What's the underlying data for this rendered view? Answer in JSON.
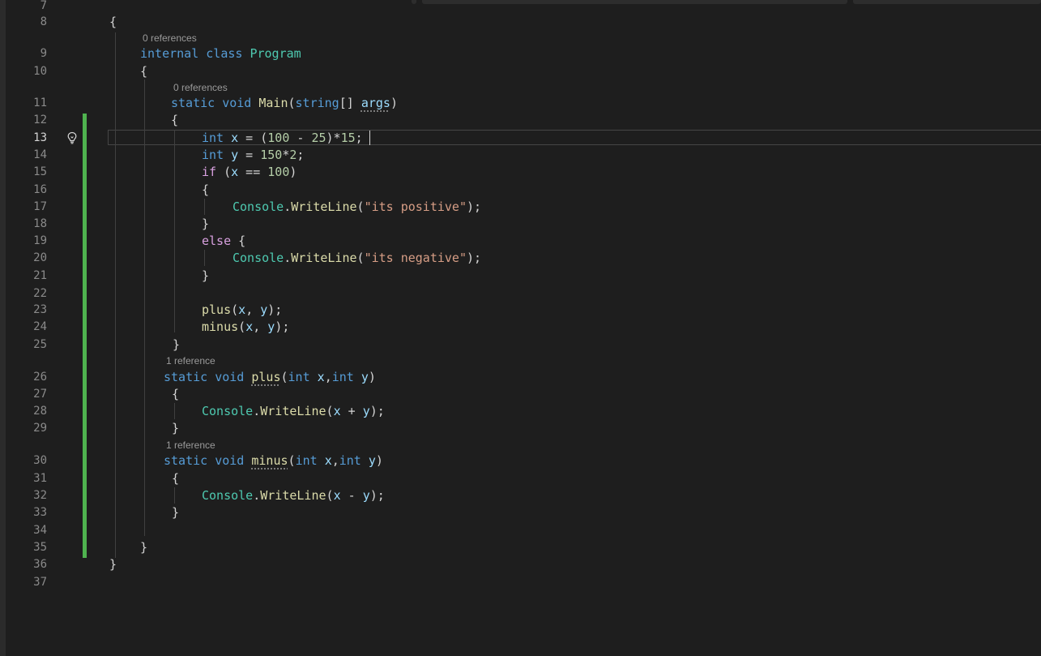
{
  "editor": {
    "active_line": "13",
    "lines": [
      {
        "num": "7"
      },
      {
        "num": "8",
        "t": [
          {
            "c": "p",
            "v": "{"
          }
        ]
      },
      {
        "lens": "0 references"
      },
      {
        "num": "9",
        "t": [
          {
            "c": "kw",
            "v": "internal class "
          },
          {
            "c": "type",
            "v": "Program"
          }
        ]
      },
      {
        "num": "10",
        "t": [
          {
            "c": "p",
            "v": "{"
          }
        ]
      },
      {
        "lens": "0 references"
      },
      {
        "num": "11",
        "t": [
          {
            "c": "kw",
            "v": "static void "
          },
          {
            "c": "fn",
            "v": "Main"
          },
          {
            "c": "p",
            "v": "("
          },
          {
            "c": "kw",
            "v": "string"
          },
          {
            "c": "p",
            "v": "[] "
          },
          {
            "c": "var squig",
            "v": "args"
          },
          {
            "c": "p",
            "v": ")"
          }
        ]
      },
      {
        "num": "12",
        "t": [
          {
            "c": "p",
            "v": "{"
          }
        ]
      },
      {
        "num": "13",
        "t": [
          {
            "c": "kw",
            "v": "int "
          },
          {
            "c": "var",
            "v": "x"
          },
          {
            "c": "p",
            "v": " = ("
          },
          {
            "c": "num",
            "v": "100"
          },
          {
            "c": "p",
            "v": " - "
          },
          {
            "c": "num",
            "v": "25"
          },
          {
            "c": "p",
            "v": ")*"
          },
          {
            "c": "num",
            "v": "15"
          },
          {
            "c": "p",
            "v": ";"
          }
        ]
      },
      {
        "num": "14",
        "t": [
          {
            "c": "kw",
            "v": "int "
          },
          {
            "c": "var",
            "v": "y"
          },
          {
            "c": "p",
            "v": " = "
          },
          {
            "c": "num",
            "v": "150"
          },
          {
            "c": "p",
            "v": "*"
          },
          {
            "c": "num",
            "v": "2"
          },
          {
            "c": "p",
            "v": ";"
          }
        ]
      },
      {
        "num": "15",
        "t": [
          {
            "c": "ctl",
            "v": "if"
          },
          {
            "c": "p",
            "v": " ("
          },
          {
            "c": "var",
            "v": "x"
          },
          {
            "c": "p",
            "v": " == "
          },
          {
            "c": "num",
            "v": "100"
          },
          {
            "c": "p",
            "v": ")"
          }
        ]
      },
      {
        "num": "16",
        "t": [
          {
            "c": "p",
            "v": "{"
          }
        ]
      },
      {
        "num": "17",
        "t": [
          {
            "c": "type",
            "v": "Console"
          },
          {
            "c": "p",
            "v": "."
          },
          {
            "c": "fn",
            "v": "WriteLine"
          },
          {
            "c": "p",
            "v": "("
          },
          {
            "c": "str",
            "v": "\"its positive\""
          },
          {
            "c": "p",
            "v": ");"
          }
        ]
      },
      {
        "num": "18",
        "t": [
          {
            "c": "p",
            "v": "}"
          }
        ]
      },
      {
        "num": "19",
        "t": [
          {
            "c": "ctl",
            "v": "else"
          },
          {
            "c": "p",
            "v": " {"
          }
        ]
      },
      {
        "num": "20",
        "t": [
          {
            "c": "type",
            "v": "Console"
          },
          {
            "c": "p",
            "v": "."
          },
          {
            "c": "fn",
            "v": "WriteLine"
          },
          {
            "c": "p",
            "v": "("
          },
          {
            "c": "str",
            "v": "\"its negative\""
          },
          {
            "c": "p",
            "v": ");"
          }
        ]
      },
      {
        "num": "21",
        "t": [
          {
            "c": "p",
            "v": "}"
          }
        ]
      },
      {
        "num": "22"
      },
      {
        "num": "23",
        "t": [
          {
            "c": "fn",
            "v": "plus"
          },
          {
            "c": "p",
            "v": "("
          },
          {
            "c": "var",
            "v": "x"
          },
          {
            "c": "p",
            "v": ", "
          },
          {
            "c": "var",
            "v": "y"
          },
          {
            "c": "p",
            "v": ");"
          }
        ]
      },
      {
        "num": "24",
        "t": [
          {
            "c": "fn",
            "v": "minus"
          },
          {
            "c": "p",
            "v": "("
          },
          {
            "c": "var",
            "v": "x"
          },
          {
            "c": "p",
            "v": ", "
          },
          {
            "c": "var",
            "v": "y"
          },
          {
            "c": "p",
            "v": ");"
          }
        ]
      },
      {
        "num": "25",
        "t": [
          {
            "c": "p",
            "v": "}"
          }
        ]
      },
      {
        "lens": "1 reference"
      },
      {
        "num": "26",
        "t": [
          {
            "c": "kw",
            "v": "static void "
          },
          {
            "c": "fn squig",
            "v": "plus"
          },
          {
            "c": "p",
            "v": "("
          },
          {
            "c": "kw",
            "v": "int "
          },
          {
            "c": "var",
            "v": "x"
          },
          {
            "c": "p",
            "v": ","
          },
          {
            "c": "kw",
            "v": "int "
          },
          {
            "c": "var",
            "v": "y"
          },
          {
            "c": "p",
            "v": ")"
          }
        ]
      },
      {
        "num": "27",
        "t": [
          {
            "c": "p",
            "v": "{"
          }
        ]
      },
      {
        "num": "28",
        "t": [
          {
            "c": "type",
            "v": "Console"
          },
          {
            "c": "p",
            "v": "."
          },
          {
            "c": "fn",
            "v": "WriteLine"
          },
          {
            "c": "p",
            "v": "("
          },
          {
            "c": "var",
            "v": "x"
          },
          {
            "c": "p",
            "v": " + "
          },
          {
            "c": "var",
            "v": "y"
          },
          {
            "c": "p",
            "v": ");"
          }
        ]
      },
      {
        "num": "29",
        "t": [
          {
            "c": "p",
            "v": "}"
          }
        ]
      },
      {
        "lens": "1 reference"
      },
      {
        "num": "30",
        "t": [
          {
            "c": "kw",
            "v": "static void "
          },
          {
            "c": "fn squig",
            "v": "minus"
          },
          {
            "c": "p",
            "v": "("
          },
          {
            "c": "kw",
            "v": "int "
          },
          {
            "c": "var",
            "v": "x"
          },
          {
            "c": "p",
            "v": ","
          },
          {
            "c": "kw",
            "v": "int "
          },
          {
            "c": "var",
            "v": "y"
          },
          {
            "c": "p",
            "v": ")"
          }
        ]
      },
      {
        "num": "31",
        "t": [
          {
            "c": "p",
            "v": "{"
          }
        ]
      },
      {
        "num": "32",
        "t": [
          {
            "c": "type",
            "v": "Console"
          },
          {
            "c": "p",
            "v": "."
          },
          {
            "c": "fn",
            "v": "WriteLine"
          },
          {
            "c": "p",
            "v": "("
          },
          {
            "c": "var",
            "v": "x"
          },
          {
            "c": "p",
            "v": " - "
          },
          {
            "c": "var",
            "v": "y"
          },
          {
            "c": "p",
            "v": ");"
          }
        ]
      },
      {
        "num": "33",
        "t": [
          {
            "c": "p",
            "v": "}"
          }
        ]
      },
      {
        "num": "34"
      },
      {
        "num": "35",
        "t": [
          {
            "c": "p",
            "v": "}"
          }
        ]
      },
      {
        "num": "36",
        "t": [
          {
            "c": "p",
            "v": "}"
          }
        ]
      },
      {
        "num": "37"
      }
    ]
  },
  "colors": {
    "background": "#1e1e1e",
    "keyword": "#569cd6",
    "control": "#d8a0df",
    "type": "#4ec9b0",
    "function": "#dcdcaa",
    "variable": "#9cdcfe",
    "number": "#b5cea8",
    "string": "#d69d85",
    "change_bar": "#4fb34f"
  },
  "icons": {
    "gutter": "lightbulb-icon"
  }
}
